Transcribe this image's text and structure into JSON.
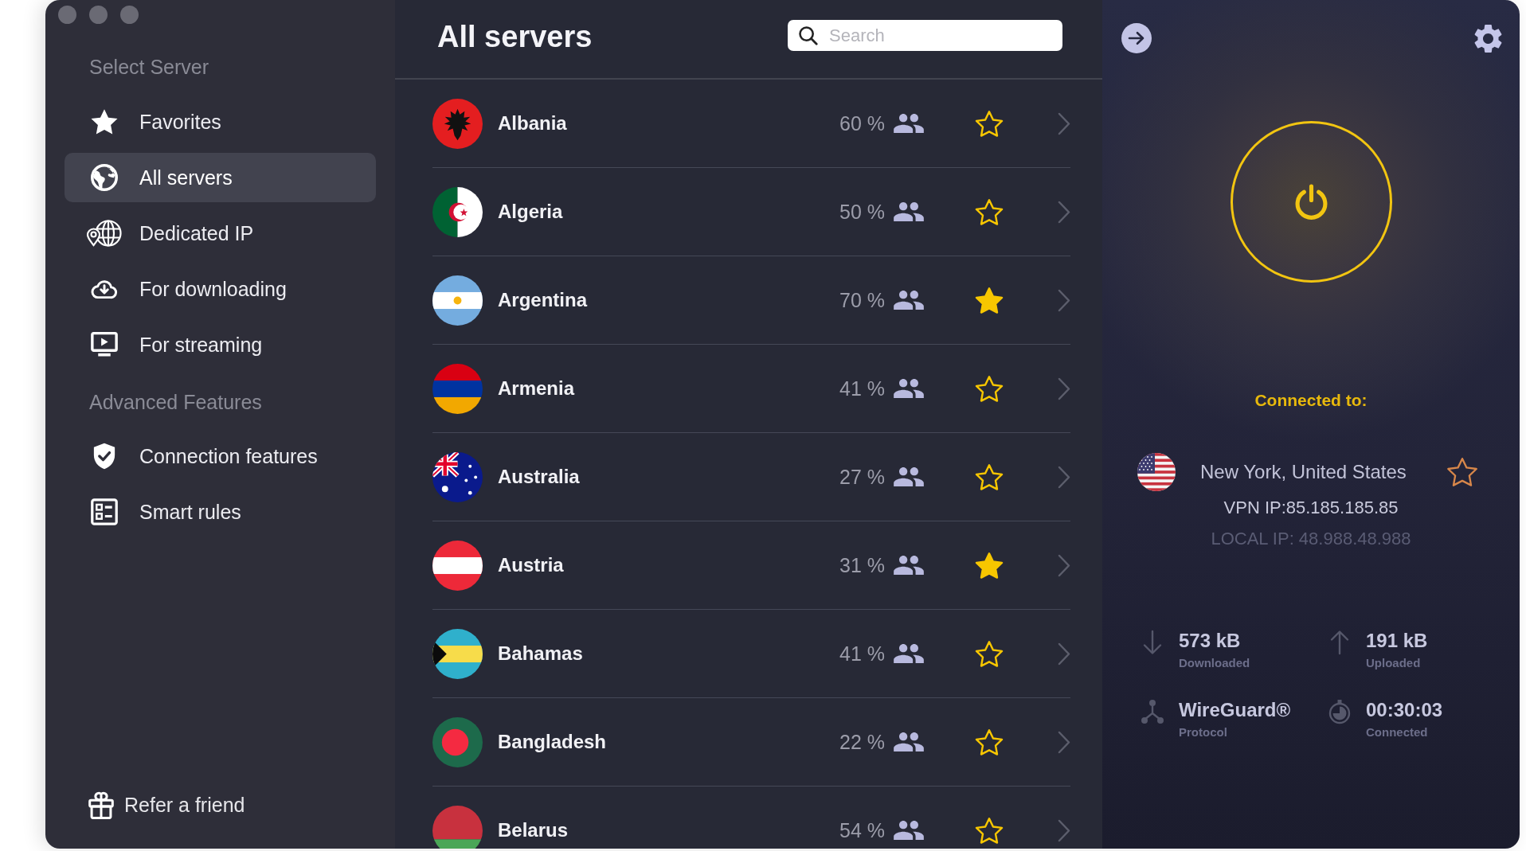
{
  "sidebar": {
    "sections": [
      {
        "heading": "Select Server",
        "items": [
          {
            "label": "Favorites",
            "selected": false
          },
          {
            "label": "All servers",
            "selected": true
          },
          {
            "label": "Dedicated IP",
            "selected": false
          },
          {
            "label": "For downloading",
            "selected": false
          },
          {
            "label": "For streaming",
            "selected": false
          }
        ]
      },
      {
        "heading": "Advanced Features",
        "items": [
          {
            "label": "Connection features",
            "selected": false
          },
          {
            "label": "Smart rules",
            "selected": false
          }
        ]
      }
    ],
    "footer_link": {
      "label": "Refer a friend"
    }
  },
  "server_list": {
    "title": "All servers",
    "search": {
      "placeholder": "Search"
    },
    "rows": [
      {
        "name": "Albania",
        "load": "60 %",
        "favorite": false
      },
      {
        "name": "Algeria",
        "load": "50 %",
        "favorite": false
      },
      {
        "name": "Argentina",
        "load": "70 %",
        "favorite": true
      },
      {
        "name": "Armenia",
        "load": "41 %",
        "favorite": false
      },
      {
        "name": "Australia",
        "load": "27 %",
        "favorite": false
      },
      {
        "name": "Austria",
        "load": "31 %",
        "favorite": true
      },
      {
        "name": "Bahamas",
        "load": "41 %",
        "favorite": false
      },
      {
        "name": "Bangladesh",
        "load": "22 %",
        "favorite": false
      },
      {
        "name": "Belarus",
        "load": "54 %",
        "favorite": false
      }
    ]
  },
  "connection": {
    "power": {
      "on": true
    },
    "status": "Connected to:",
    "location": "New York, United States",
    "favorite": false,
    "vpn_ip": "VPN IP:85.185.185.85",
    "local_ip": "LOCAL IP: 48.988.48.988",
    "stats": [
      {
        "kind": "download",
        "value": "573 kB",
        "label": "Downloaded"
      },
      {
        "kind": "upload",
        "value": "191 kB",
        "label": "Uploaded"
      },
      {
        "kind": "protocol",
        "value": "WireGuard®",
        "label": "Protocol"
      },
      {
        "kind": "timer",
        "value": "00:30:03",
        "label": "Connected"
      }
    ]
  }
}
